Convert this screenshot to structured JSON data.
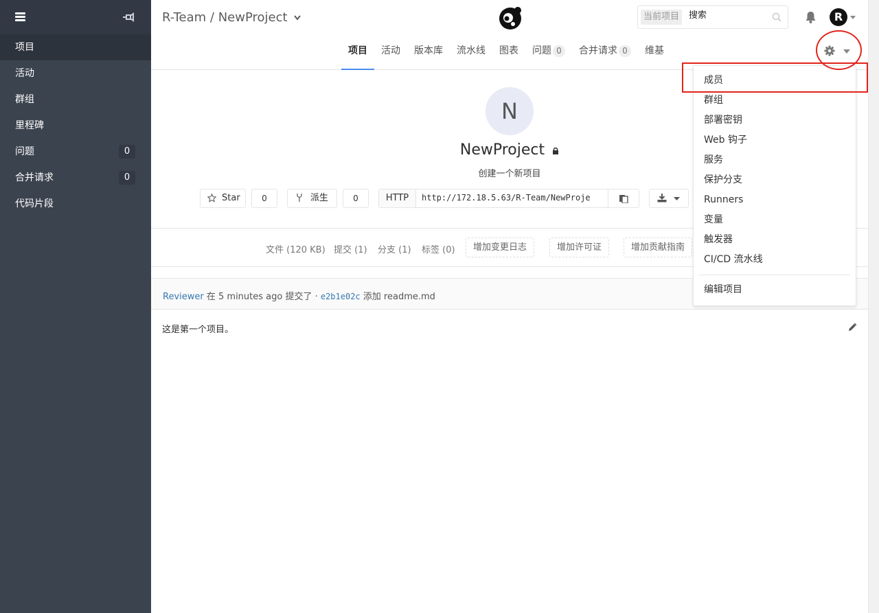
{
  "sidebar": {
    "items": [
      {
        "label": "项目",
        "count": ""
      },
      {
        "label": "活动",
        "count": ""
      },
      {
        "label": "群组",
        "count": ""
      },
      {
        "label": "里程碑",
        "count": ""
      },
      {
        "label": "问题",
        "count": "0"
      },
      {
        "label": "合并请求",
        "count": "0"
      },
      {
        "label": "代码片段",
        "count": ""
      }
    ]
  },
  "header": {
    "breadcrumb": "R-Team / NewProject",
    "search_scope": "当前项目",
    "search_placeholder": "搜索",
    "avatar_letter": "R"
  },
  "nav": {
    "tabs": [
      {
        "label": "项目",
        "count": ""
      },
      {
        "label": "活动",
        "count": ""
      },
      {
        "label": "版本库",
        "count": ""
      },
      {
        "label": "流水线",
        "count": ""
      },
      {
        "label": "图表",
        "count": ""
      },
      {
        "label": "问题",
        "count": "0"
      },
      {
        "label": "合并请求",
        "count": "0"
      },
      {
        "label": "维基",
        "count": ""
      }
    ]
  },
  "settings_menu": {
    "items": [
      "成员",
      "群组",
      "部署密钥",
      "Web 钩子",
      "服务",
      "保护分支",
      "Runners",
      "变量",
      "触发器",
      "CI/CD 流水线"
    ],
    "footer_item": "编辑项目"
  },
  "project": {
    "avatar_letter": "N",
    "name": "NewProject",
    "description": "创建一个新项目",
    "star_label": "Star",
    "star_count": "0",
    "fork_label": "派生",
    "fork_count": "0",
    "protocol": "HTTP",
    "clone_url": "http://172.18.5.63/R-Team/NewProje"
  },
  "stats": {
    "files": "文件 (120 KB)",
    "commits": "提交 (1)",
    "branches": "分支 (1)",
    "tags": "标签 (0)",
    "add_changelog": "增加变更日志",
    "add_license": "增加许可证",
    "add_contrib": "增加贡献指南"
  },
  "commit": {
    "author": "Reviewer",
    "text_mid": " 在 5 minutes ago 提交了 · ",
    "hash": "e2b1e02c",
    "message": " 添加 readme.md"
  },
  "readme": {
    "content": "这是第一个项目。"
  },
  "colors": {
    "sidebar_bg": "#3b434f",
    "accent": "#4a8bee",
    "annotation": "#e2231a",
    "link": "#3777b0"
  }
}
